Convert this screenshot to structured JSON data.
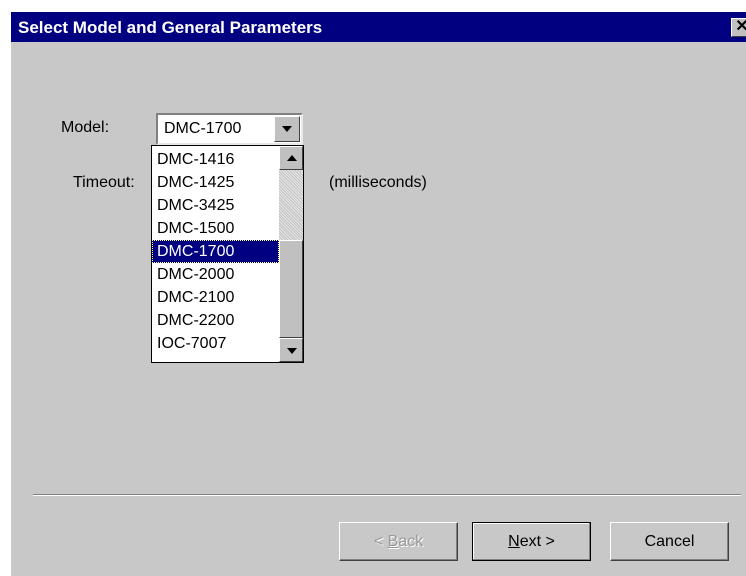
{
  "window": {
    "title": "Select Model and General Parameters",
    "close_glyph": "✕",
    "title_bar_color": "#000080",
    "background_color": "#c8c8c8"
  },
  "form": {
    "model_label": "Model:",
    "model_value": "DMC-1700",
    "timeout_label": "Timeout:",
    "timeout_units": "(milliseconds)"
  },
  "dropdown": {
    "selected_index": 4,
    "items": [
      "DMC-1416",
      "DMC-1425",
      "DMC-3425",
      "DMC-1500",
      "DMC-1700",
      "DMC-2000",
      "DMC-2100",
      "DMC-2200",
      "IOC-7007"
    ],
    "icons": {
      "scroll_up": "triangle-up-icon",
      "scroll_down": "triangle-down-icon",
      "combo_arrow": "triangle-down-icon"
    }
  },
  "buttons": {
    "back": {
      "prefix": "< ",
      "mnemonic": "B",
      "rest": "ack",
      "enabled": false
    },
    "next": {
      "mnemonic": "N",
      "rest": "ext >",
      "enabled": true
    },
    "cancel": {
      "label": "Cancel",
      "enabled": true
    }
  }
}
